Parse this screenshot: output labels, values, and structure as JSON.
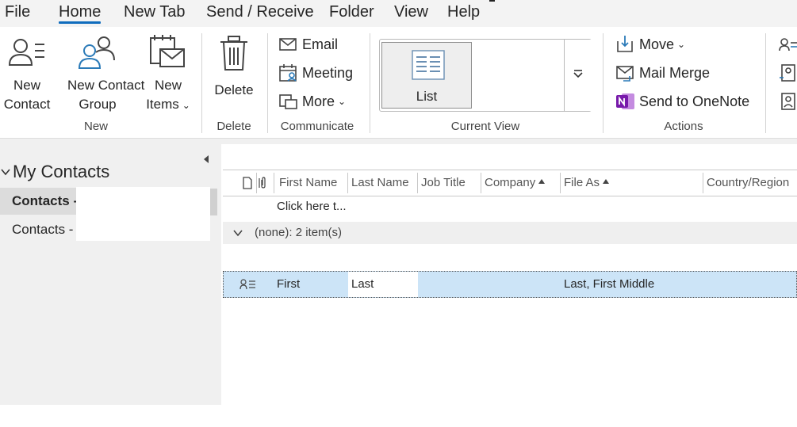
{
  "menu": {
    "file": "File",
    "home": "Home",
    "new_tab": "New Tab",
    "send_receive": "Send / Receive",
    "folder": "Folder",
    "view": "View",
    "help": "Help"
  },
  "ribbon": {
    "new_group": {
      "label": "New",
      "new_contact": [
        "New",
        "Contact"
      ],
      "new_contact_group": [
        "New Contact",
        "Group"
      ],
      "new_items": [
        "New",
        "Items"
      ]
    },
    "delete_group": {
      "label": "Delete",
      "delete": "Delete"
    },
    "communicate_group": {
      "label": "Communicate",
      "email": "Email",
      "meeting": "Meeting",
      "more": "More"
    },
    "current_view_group": {
      "label": "Current View",
      "list": "List"
    },
    "actions_group": {
      "label": "Actions",
      "move": "Move",
      "mail_merge": "Mail Merge",
      "send_to_onenote": "Send to OneNote"
    }
  },
  "nav": {
    "header": "My Contacts",
    "items": [
      "Contacts -",
      "Contacts -"
    ]
  },
  "table": {
    "columns": [
      "First Name",
      "Last Name",
      "Job Title",
      "Company",
      "File As",
      "Country/Region"
    ],
    "new_item_placeholder": "Click here t...",
    "group_header": "(none): 2 item(s)",
    "rows": [
      {
        "first": "First",
        "last": "Last",
        "file_as": "Last, First Middle"
      }
    ]
  },
  "colors": {
    "accent": "#0f6cbd",
    "selection": "#cce4f7",
    "onenote": "#7719aa"
  }
}
